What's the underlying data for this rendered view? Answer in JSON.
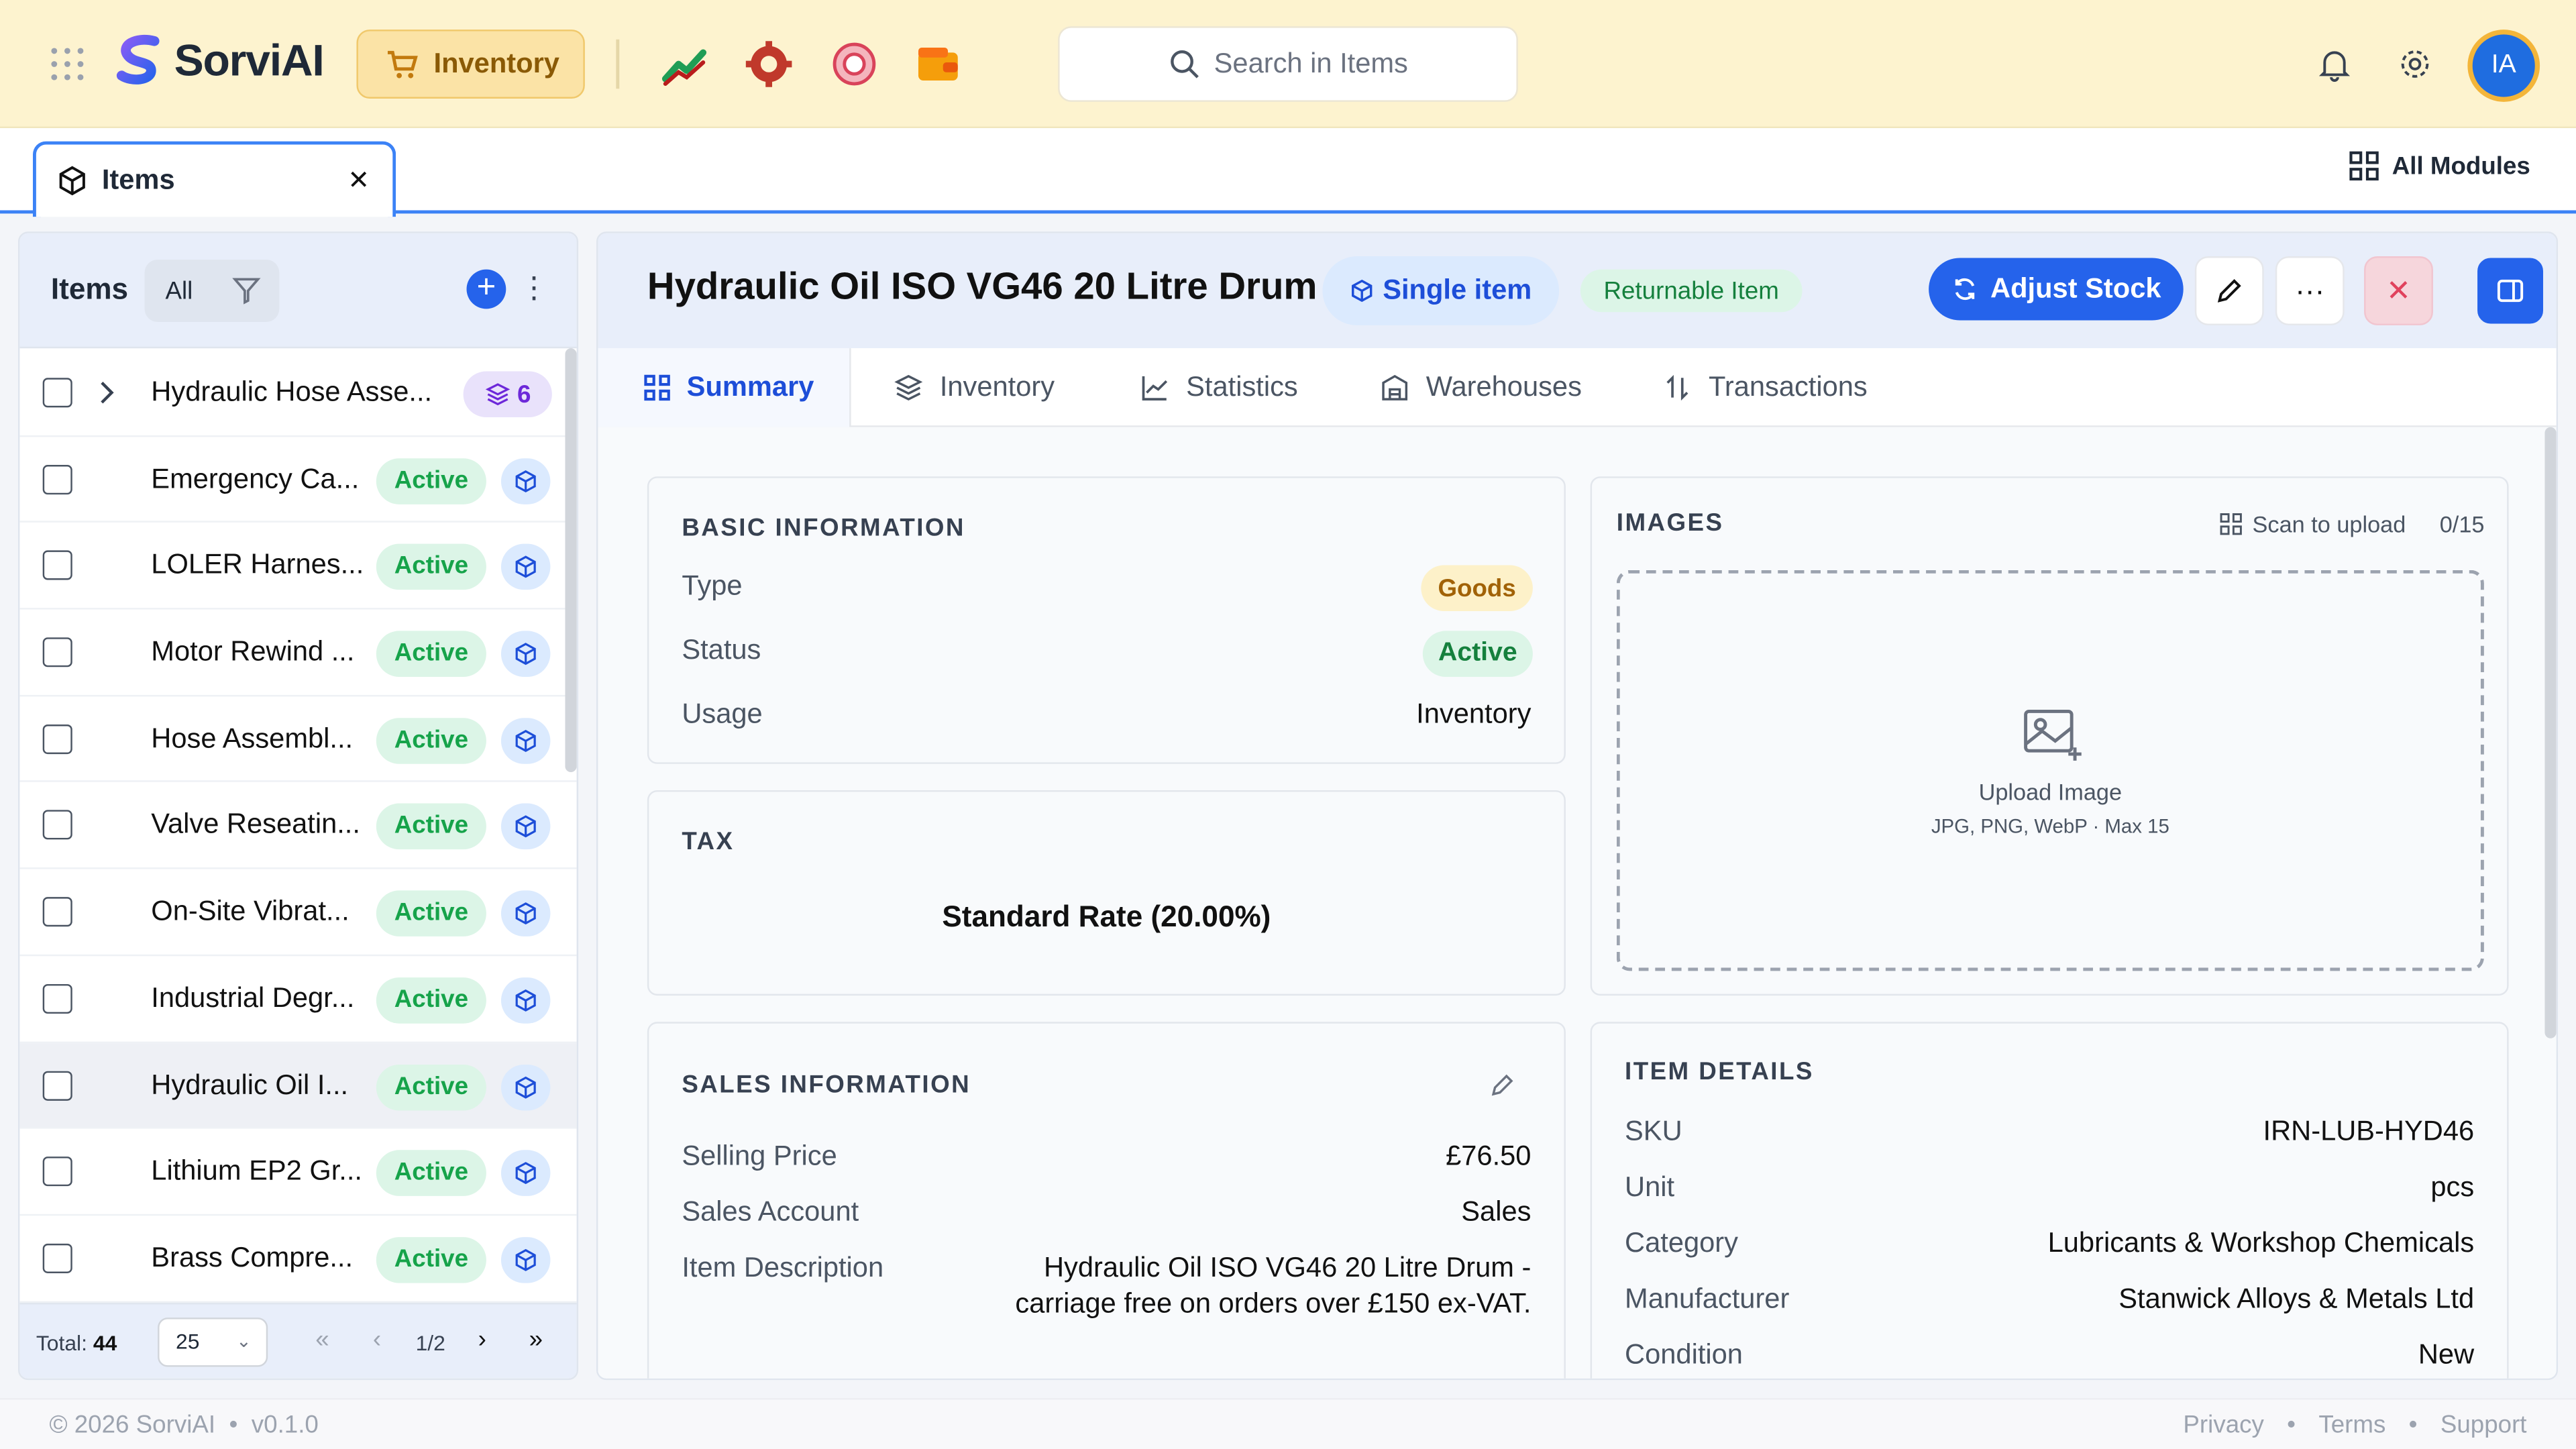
{
  "app": {
    "name": "SorviAI",
    "module": "Inventory"
  },
  "search": {
    "placeholder": "Search in Items"
  },
  "user": {
    "initials": "IA"
  },
  "tabs": {
    "active": "Items",
    "all_modules": "All Modules"
  },
  "list": {
    "title": "Items",
    "filter_all": "All",
    "items": [
      {
        "name": "Hydraulic Hose Asse...",
        "variants": "6"
      },
      {
        "name": "Emergency Ca...",
        "status": "Active"
      },
      {
        "name": "LOLER Harnes...",
        "status": "Active"
      },
      {
        "name": "Motor Rewind ...",
        "status": "Active"
      },
      {
        "name": "Hose Assembl...",
        "status": "Active"
      },
      {
        "name": "Valve Reseatin...",
        "status": "Active"
      },
      {
        "name": "On-Site Vibrat...",
        "status": "Active"
      },
      {
        "name": "Industrial Degr...",
        "status": "Active"
      },
      {
        "name": "Hydraulic Oil I...",
        "status": "Active"
      },
      {
        "name": "Lithium EP2 Gr...",
        "status": "Active"
      },
      {
        "name": "Brass Compre...",
        "status": "Active"
      }
    ],
    "selected_index": 8,
    "total_label": "Total:",
    "total": "44",
    "page_size": "25",
    "page_info": "1/2"
  },
  "item": {
    "title": "Hydraulic Oil ISO VG46 20 Litre Drum",
    "kind": "Single item",
    "returnable": "Returnable Item",
    "adjust_stock": "Adjust Stock"
  },
  "item_tabs": [
    "Summary",
    "Inventory",
    "Statistics",
    "Warehouses",
    "Transactions"
  ],
  "basic": {
    "title": "BASIC INFORMATION",
    "type_label": "Type",
    "type": "Goods",
    "status_label": "Status",
    "status": "Active",
    "usage_label": "Usage",
    "usage": "Inventory"
  },
  "tax": {
    "title": "TAX",
    "value": "Standard Rate (20.00%)"
  },
  "sales": {
    "title": "SALES INFORMATION",
    "price_label": "Selling Price",
    "price": "£76.50",
    "account_label": "Sales Account",
    "account": "Sales",
    "desc_label": "Item Description",
    "desc_line1": "Hydraulic Oil ISO VG46 20 Litre Drum -",
    "desc_line2": "carriage free on orders over £150 ex-VAT."
  },
  "images": {
    "title": "IMAGES",
    "scan": "Scan to upload",
    "count": "0/15",
    "upload": "Upload Image",
    "hint": "JPG, PNG, WebP · Max 15"
  },
  "details": {
    "title": "ITEM DETAILS",
    "sku_label": "SKU",
    "sku": "IRN-LUB-HYD46",
    "unit_label": "Unit",
    "unit": "pcs",
    "category_label": "Category",
    "category": "Lubricants & Workshop Chemicals",
    "manufacturer_label": "Manufacturer",
    "manufacturer": "Stanwick Alloys & Metals Ltd",
    "condition_label": "Condition",
    "condition": "New"
  },
  "footer": {
    "copyright": "© 2026 SorviAI",
    "version": "v0.1.0",
    "links": [
      "Privacy",
      "Terms",
      "Support"
    ]
  }
}
